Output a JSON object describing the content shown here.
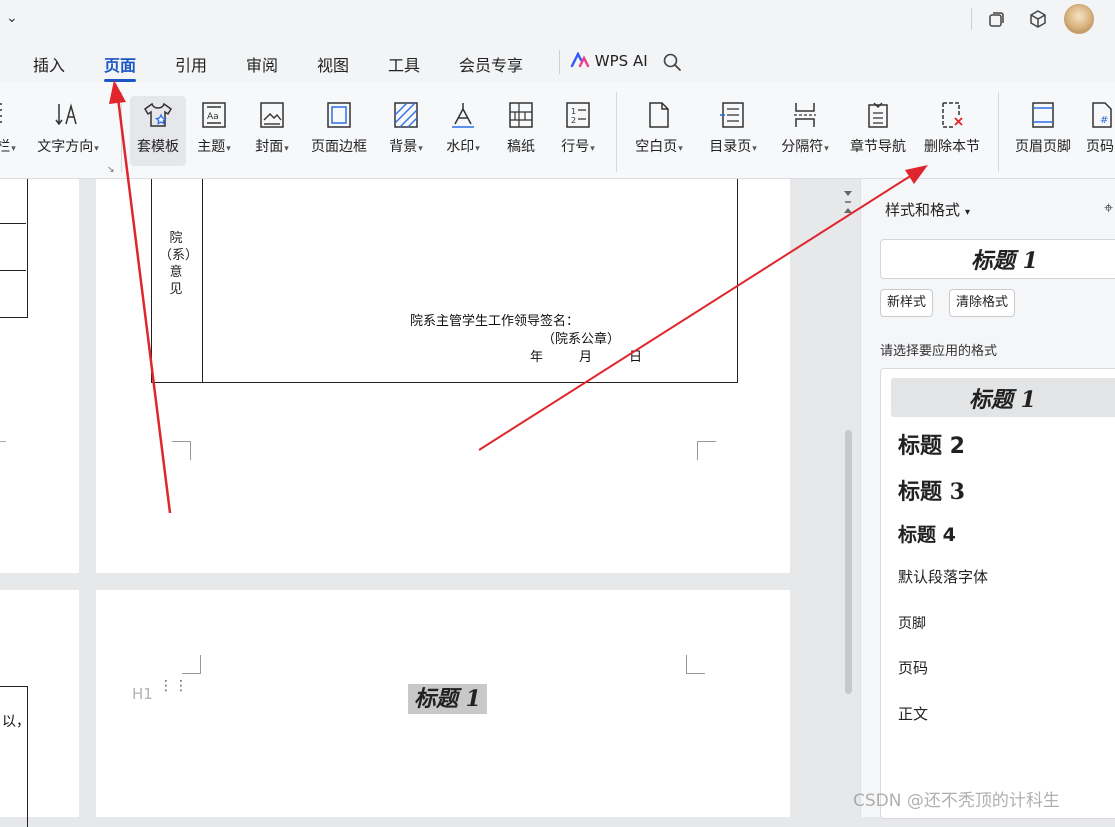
{
  "tabs": [
    {
      "label": "插入"
    },
    {
      "label": "页面"
    },
    {
      "label": "引用"
    },
    {
      "label": "审阅"
    },
    {
      "label": "视图"
    },
    {
      "label": "工具"
    },
    {
      "label": "会员专享"
    }
  ],
  "wps_ai": {
    "label": "WPS AI"
  },
  "ribbon": [
    {
      "label": "栏"
    },
    {
      "label": "文字方向"
    },
    {
      "label": "套模板"
    },
    {
      "label": "主题"
    },
    {
      "label": "封面"
    },
    {
      "label": "页面边框"
    },
    {
      "label": "背景"
    },
    {
      "label": "水印"
    },
    {
      "label": "稿纸"
    },
    {
      "label": "行号"
    },
    {
      "label": "空白页"
    },
    {
      "label": "目录页"
    },
    {
      "label": "分隔符"
    },
    {
      "label": "章节导航"
    },
    {
      "label": "删除本节"
    },
    {
      "label": "页眉页脚"
    },
    {
      "label": "页码"
    }
  ],
  "document": {
    "table_side_label": [
      "院",
      "（系）",
      "意",
      "见"
    ],
    "signature_line": "院系主管学生工作领导签名：",
    "seal_line": "（院系公章）",
    "date_year": "年",
    "date_month": "月",
    "date_day": "日",
    "heading_marker": "H1",
    "heading_text": "标题 1",
    "left_partial_text": "以，"
  },
  "styles_panel": {
    "title": "样式和格式",
    "current_style": "标题 1",
    "new_style_button": "新样式",
    "clear_format_button": "清除格式",
    "prompt": "请选择要应用的格式",
    "styles": [
      {
        "label": "标题 1"
      },
      {
        "label": "标题 2"
      },
      {
        "label": "标题 3"
      },
      {
        "label": "标题 4"
      },
      {
        "label": "默认段落字体"
      },
      {
        "label": "页脚"
      },
      {
        "label": "页码"
      },
      {
        "label": "正文"
      }
    ]
  },
  "watermark": "CSDN @还不秃顶的计科生",
  "colors": {
    "accent": "#1a56c4",
    "annotation_arrow": "#e0262d"
  }
}
